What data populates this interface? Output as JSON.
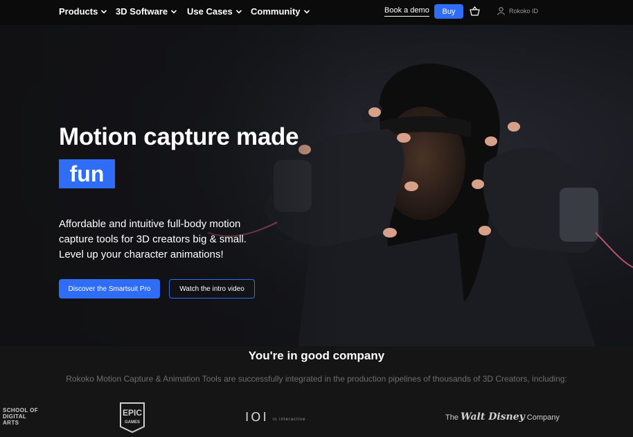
{
  "nav": {
    "items": [
      {
        "label": "Products"
      },
      {
        "label": "3D Software"
      },
      {
        "label": "Use Cases"
      },
      {
        "label": "Community"
      }
    ],
    "book_demo": "Book a demo",
    "buy": "Buy",
    "account": "Rokoko ID",
    "icons": {
      "dropdown": "chevron-down-icon",
      "cart": "basket-icon",
      "user": "user-icon"
    }
  },
  "hero": {
    "headline": "Motion capture made",
    "highlight": "fun",
    "subcopy": [
      "Affordable and intuitive full-body motion",
      "capture tools for 3D creators big & small.",
      "Level up your character animations!"
    ],
    "primary_cta": "Discover the Smartsuit Pro",
    "secondary_cta": "Watch the intro video"
  },
  "company": {
    "title": "You're in good company",
    "subtitle": "Rokoko Motion Capture & Animation Tools are successfully integrated in the production pipelines of thousands of 3D Creators, including:",
    "logos": {
      "sda": [
        "SCHOOL OF",
        "DIGITAL",
        "ARTS"
      ],
      "epic": [
        "EPIC",
        "GAMES"
      ],
      "ioi": {
        "mark": "IOI",
        "tag": "io interactive"
      },
      "disney": {
        "pre": "The",
        "brand": "Walt Disney",
        "post": "Company"
      }
    }
  },
  "colors": {
    "accent": "#2f6df6",
    "background": "#151515",
    "nav": "#0b0b0b"
  }
}
